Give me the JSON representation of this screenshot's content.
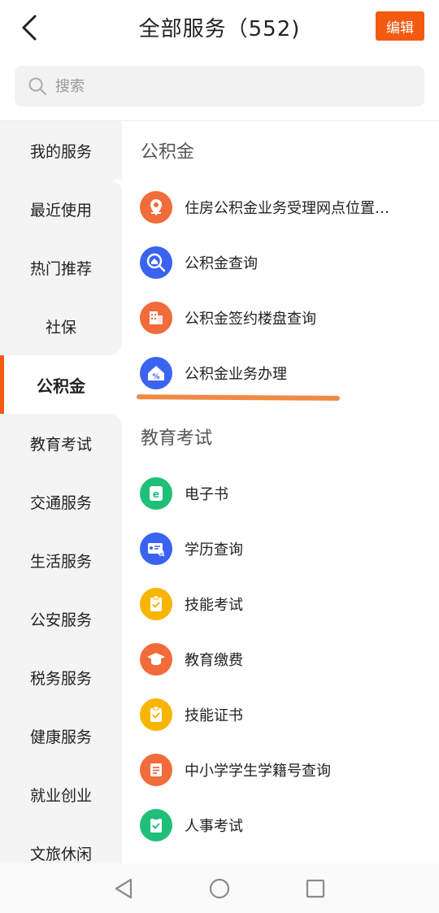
{
  "header": {
    "title": "全部服务（552)",
    "edit_label": "编辑"
  },
  "search": {
    "placeholder": "搜索"
  },
  "sidebar": {
    "items": [
      {
        "label": "我的服务"
      },
      {
        "label": "最近使用"
      },
      {
        "label": "热门推荐"
      },
      {
        "label": "社保"
      },
      {
        "label": "公积金",
        "active": true
      },
      {
        "label": "教育考试"
      },
      {
        "label": "交通服务"
      },
      {
        "label": "生活服务"
      },
      {
        "label": "公安服务"
      },
      {
        "label": "税务服务"
      },
      {
        "label": "健康服务"
      },
      {
        "label": "就业创业"
      },
      {
        "label": "文旅休闲"
      }
    ]
  },
  "sections": [
    {
      "title": "公积金",
      "items": [
        {
          "label": "住房公积金业务受理网点位置…",
          "icon": "location-pin-icon",
          "color": "#f26b3a"
        },
        {
          "label": "公积金查询",
          "icon": "magnifier-search-icon",
          "color": "#3a63f0"
        },
        {
          "label": "公积金签约楼盘查询",
          "icon": "building-icon",
          "color": "#f26b3a"
        },
        {
          "label": "公积金业务办理",
          "icon": "house-percent-icon",
          "color": "#3a63f0"
        }
      ]
    },
    {
      "title": "教育考试",
      "items": [
        {
          "label": "电子书",
          "icon": "ebook-icon",
          "color": "#1fbf7a"
        },
        {
          "label": "学历查询",
          "icon": "certificate-search-icon",
          "color": "#3a63f0"
        },
        {
          "label": "技能考试",
          "icon": "clipboard-check-icon",
          "color": "#f7b500"
        },
        {
          "label": "教育缴费",
          "icon": "graduation-cap-icon",
          "color": "#f26b3a"
        },
        {
          "label": "技能证书",
          "icon": "clipboard-check-icon",
          "color": "#f7b500"
        },
        {
          "label": "中小学学生学籍号查询",
          "icon": "student-card-icon",
          "color": "#f26b3a"
        },
        {
          "label": "人事考试",
          "icon": "document-check-icon",
          "color": "#1fbf7a"
        }
      ]
    }
  ],
  "colors": {
    "accent": "#f35a12",
    "underline": "#ef8a45"
  }
}
